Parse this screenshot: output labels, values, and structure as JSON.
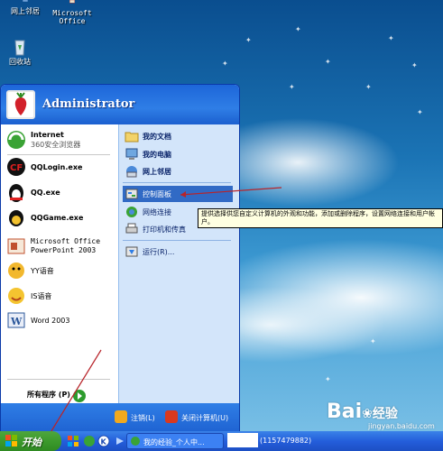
{
  "desktop": {
    "icons": [
      {
        "label": "网上邻居"
      },
      {
        "label": "Microsoft Office"
      },
      {
        "label": "回收站"
      }
    ],
    "watermark": {
      "brand": "Bai",
      "brand2": "经验",
      "url": "jingyan.baidu.com"
    }
  },
  "start_menu": {
    "username": "Administrator",
    "left_items": [
      {
        "title": "Internet",
        "subtitle": "360安全浏览器"
      },
      {
        "title": "QQLogin.exe"
      },
      {
        "title": "QQ.exe"
      },
      {
        "title": "QQGame.exe"
      },
      {
        "title": "Microsoft Office",
        "subtitle": "PowerPoint 2003"
      },
      {
        "title": "YY语音"
      },
      {
        "title": "IS语音"
      },
      {
        "title": "Word 2003"
      }
    ],
    "all_programs": "所有程序 (P)",
    "right_items": [
      {
        "label": "我的文档"
      },
      {
        "label": "我的电脑"
      },
      {
        "label": "网上邻居"
      },
      {
        "label": "控制面板"
      },
      {
        "label": "网络连接"
      },
      {
        "label": "打印机和传真"
      },
      {
        "label": "运行(R)..."
      }
    ],
    "footer": {
      "logoff": "注销(L)",
      "shutdown": "关闭计算机(U)"
    }
  },
  "tooltip": {
    "text": "提供选择供您自定义计算机的外观和功能，添加或删除程序，设置网络连接和用户帐户。"
  },
  "taskbar": {
    "start_label": "开始",
    "tasks": [
      {
        "label": "我的经验_个人中..."
      },
      {
        "label": "(1157479882)"
      }
    ]
  }
}
